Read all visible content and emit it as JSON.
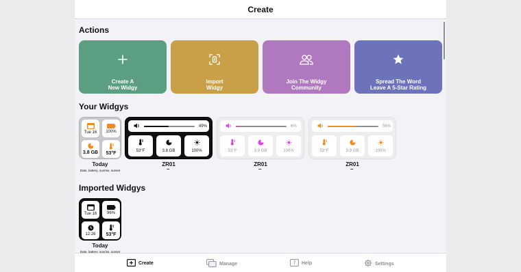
{
  "nav": {
    "title": "Create"
  },
  "sections": {
    "actions": "Actions",
    "your_widgys": "Your Widgys",
    "imported_widgys": "Imported Widgys"
  },
  "actions": [
    {
      "label": "Create A\nNew Widgy",
      "color": "#5c9e81",
      "icon": "plus-icon"
    },
    {
      "label": "Import\nWidgy",
      "color": "#c9a047",
      "icon": "import-icon"
    },
    {
      "label": "Join The Widgy\nCommunity",
      "color": "#b079bf",
      "icon": "people-icon"
    },
    {
      "label": "Spread The Word\nLeave A 5-Star Rating",
      "color": "#6c73bb",
      "icon": "star-icon"
    }
  ],
  "your_widgys": {
    "today": {
      "name": "Today",
      "subtitle": "Date, battery, sunrise, sunset",
      "date": "Tue 16",
      "battery": "100%",
      "storage": "3.8 GB",
      "temp": "53°F"
    },
    "zr01_dark": {
      "name": "ZR01",
      "dash": "–",
      "volume": "49%",
      "temp": "53°F",
      "storage": "3.8 GB",
      "brightness": "100%",
      "accent": "#111111"
    },
    "zr01_pink": {
      "name": "ZR01",
      "dash": "–",
      "volume": "6%",
      "temp": "53°F",
      "storage": "3.9 GB",
      "brightness": "100%",
      "accent": "#e040e6"
    },
    "zr01_orange": {
      "name": "ZR01",
      "dash": "–",
      "volume": "56%",
      "temp": "53°F",
      "storage": "3.9 GB",
      "brightness": "100%",
      "accent": "#f08a18"
    }
  },
  "imported_widgys": {
    "today": {
      "name": "Today",
      "subtitle": "Date, battery, sunrise, sunset",
      "date": "Tue 16",
      "battery": "96%",
      "time": "12:26",
      "temp": "53°F"
    }
  },
  "tabs": [
    {
      "label": "Create",
      "icon": "add-square-icon",
      "active": true
    },
    {
      "label": "Manage",
      "icon": "stack-icon",
      "active": false
    },
    {
      "label": "Help",
      "icon": "help-icon",
      "active": false
    },
    {
      "label": "Settings",
      "icon": "gear-icon",
      "active": false
    }
  ]
}
